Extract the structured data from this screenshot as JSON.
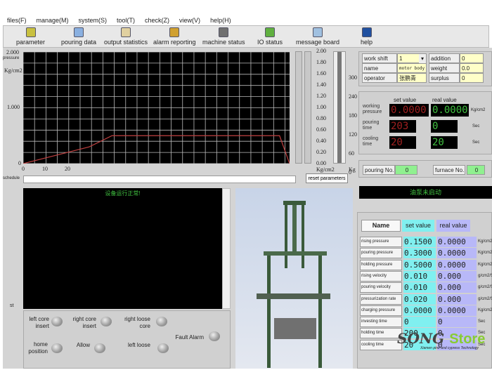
{
  "menu": [
    "files(F)",
    "manage(M)",
    "system(S)",
    "tool(T)",
    "check(Z)",
    "view(V)",
    "help(H)"
  ],
  "toolbar": [
    {
      "label": "parameter",
      "icon": "parameter-icon",
      "color": "#c8c040"
    },
    {
      "label": "pouring data",
      "icon": "pouring-data-icon",
      "color": "#8ab0e0"
    },
    {
      "label": "output statistics",
      "icon": "output-statistics-icon",
      "color": "#e0d0a0"
    },
    {
      "label": "alarm reporting",
      "icon": "alarm-reporting-icon",
      "color": "#d0a030"
    },
    {
      "label": "machine status",
      "icon": "machine-status-icon",
      "color": "#707070"
    },
    {
      "label": "IO status",
      "icon": "io-status-icon",
      "color": "#60b040"
    },
    {
      "label": "message board",
      "icon": "message-board-icon",
      "color": "#a0c0e0"
    },
    {
      "label": "help",
      "icon": "help-icon",
      "color": "#2050a0"
    }
  ],
  "chart_data": {
    "type": "line",
    "ylabel": "pressure",
    "yunit": "Kg/cm2",
    "yticks": [
      "2.000",
      "1.000",
      "0"
    ],
    "xticks": [
      "0",
      "10",
      "20"
    ],
    "ylim": [
      0,
      2
    ],
    "xlim": [
      0,
      117
    ],
    "grid": true,
    "series": [
      {
        "color": "#c04040",
        "x": [
          0,
          29,
          39,
          112.6,
          117
        ],
        "y": [
          0,
          0.3,
          0.5,
          0.5,
          0
        ]
      }
    ]
  },
  "schedule_label": "schedule",
  "gauge1": {
    "ticks": [
      "2.00",
      "1.80",
      "1.60",
      "1.40",
      "1.20",
      "1.00",
      "0.80",
      "0.60",
      "0.40",
      "0.20",
      "0.00"
    ],
    "unit": "Kg/cm2"
  },
  "gauge2": {
    "ticks": [
      "300",
      "240",
      "180",
      "120",
      "60",
      "0"
    ],
    "unit": "Kg"
  },
  "reset_label": "reset parameters",
  "info": {
    "work_shift_label": "work shift",
    "work_shift": "1",
    "name_label": "name",
    "name": "motor body",
    "operator_label": "operator",
    "operator": "张鹏青",
    "addition_label": "addition",
    "addition": "0",
    "weight_label": "weight",
    "weight": "0.0",
    "surplus_label": "surplus",
    "surplus": "0"
  },
  "readout": {
    "set_label": "set value",
    "real_label": "real value",
    "rows": [
      {
        "label": "working pressure",
        "set": "0.0000",
        "real": "0.0000",
        "unit": "Kg/cm2"
      },
      {
        "label": "pouring time",
        "set": "203",
        "real": "0",
        "unit": "Sec"
      },
      {
        "label": "cooling time",
        "set": "20",
        "real": "20",
        "unit": "Sec"
      }
    ]
  },
  "pouring_no_label": "pouring No.",
  "pouring_no": "0",
  "furnace_no_label": "furnace No.",
  "furnace_no": "0",
  "console_message": "设备运行正常!",
  "pump_status": "油泵未启动",
  "side_label": "st",
  "table": {
    "headers": [
      "Name",
      "set value",
      "real value"
    ],
    "rows": [
      {
        "name": "rising pressure",
        "set": "0.1500",
        "real": "0.0000",
        "unit": "Kg/cm2"
      },
      {
        "name": "pouring pressure",
        "set": "0.3000",
        "real": "0.0000",
        "unit": "Kg/cm2"
      },
      {
        "name": "holding pressure",
        "set": "0.5000",
        "real": "0.0000",
        "unit": "Kg/cm2"
      },
      {
        "name": "rising velocity",
        "set": "0.010",
        "real": "0.000",
        "unit": "g/cm2/S"
      },
      {
        "name": "pouring velocity",
        "set": "0.010",
        "real": "0.000",
        "unit": "g/cm2/S"
      },
      {
        "name": "pressurization rate",
        "set": "0.020",
        "real": "0.000",
        "unit": "g/cm2/S"
      },
      {
        "name": "charging pressure",
        "set": "0.0000",
        "real": "0.0000",
        "unit": "Kg/cm2"
      },
      {
        "name": "investing time",
        "set": "0",
        "real": "0",
        "unit": "Sec"
      },
      {
        "name": "holding time",
        "set": "200",
        "real": "0",
        "unit": "Sec"
      },
      {
        "name": "cooling time",
        "set": "20",
        "real": "0",
        "unit": "Sec"
      }
    ]
  },
  "indicators": [
    "left core insert",
    "right core insert",
    "right loose core",
    "Fault Alarm",
    "home position",
    "Allow",
    "left loose"
  ],
  "watermark": {
    "brand": "SONG Store",
    "tagline": "Xiamen pine and cypress Technology"
  }
}
